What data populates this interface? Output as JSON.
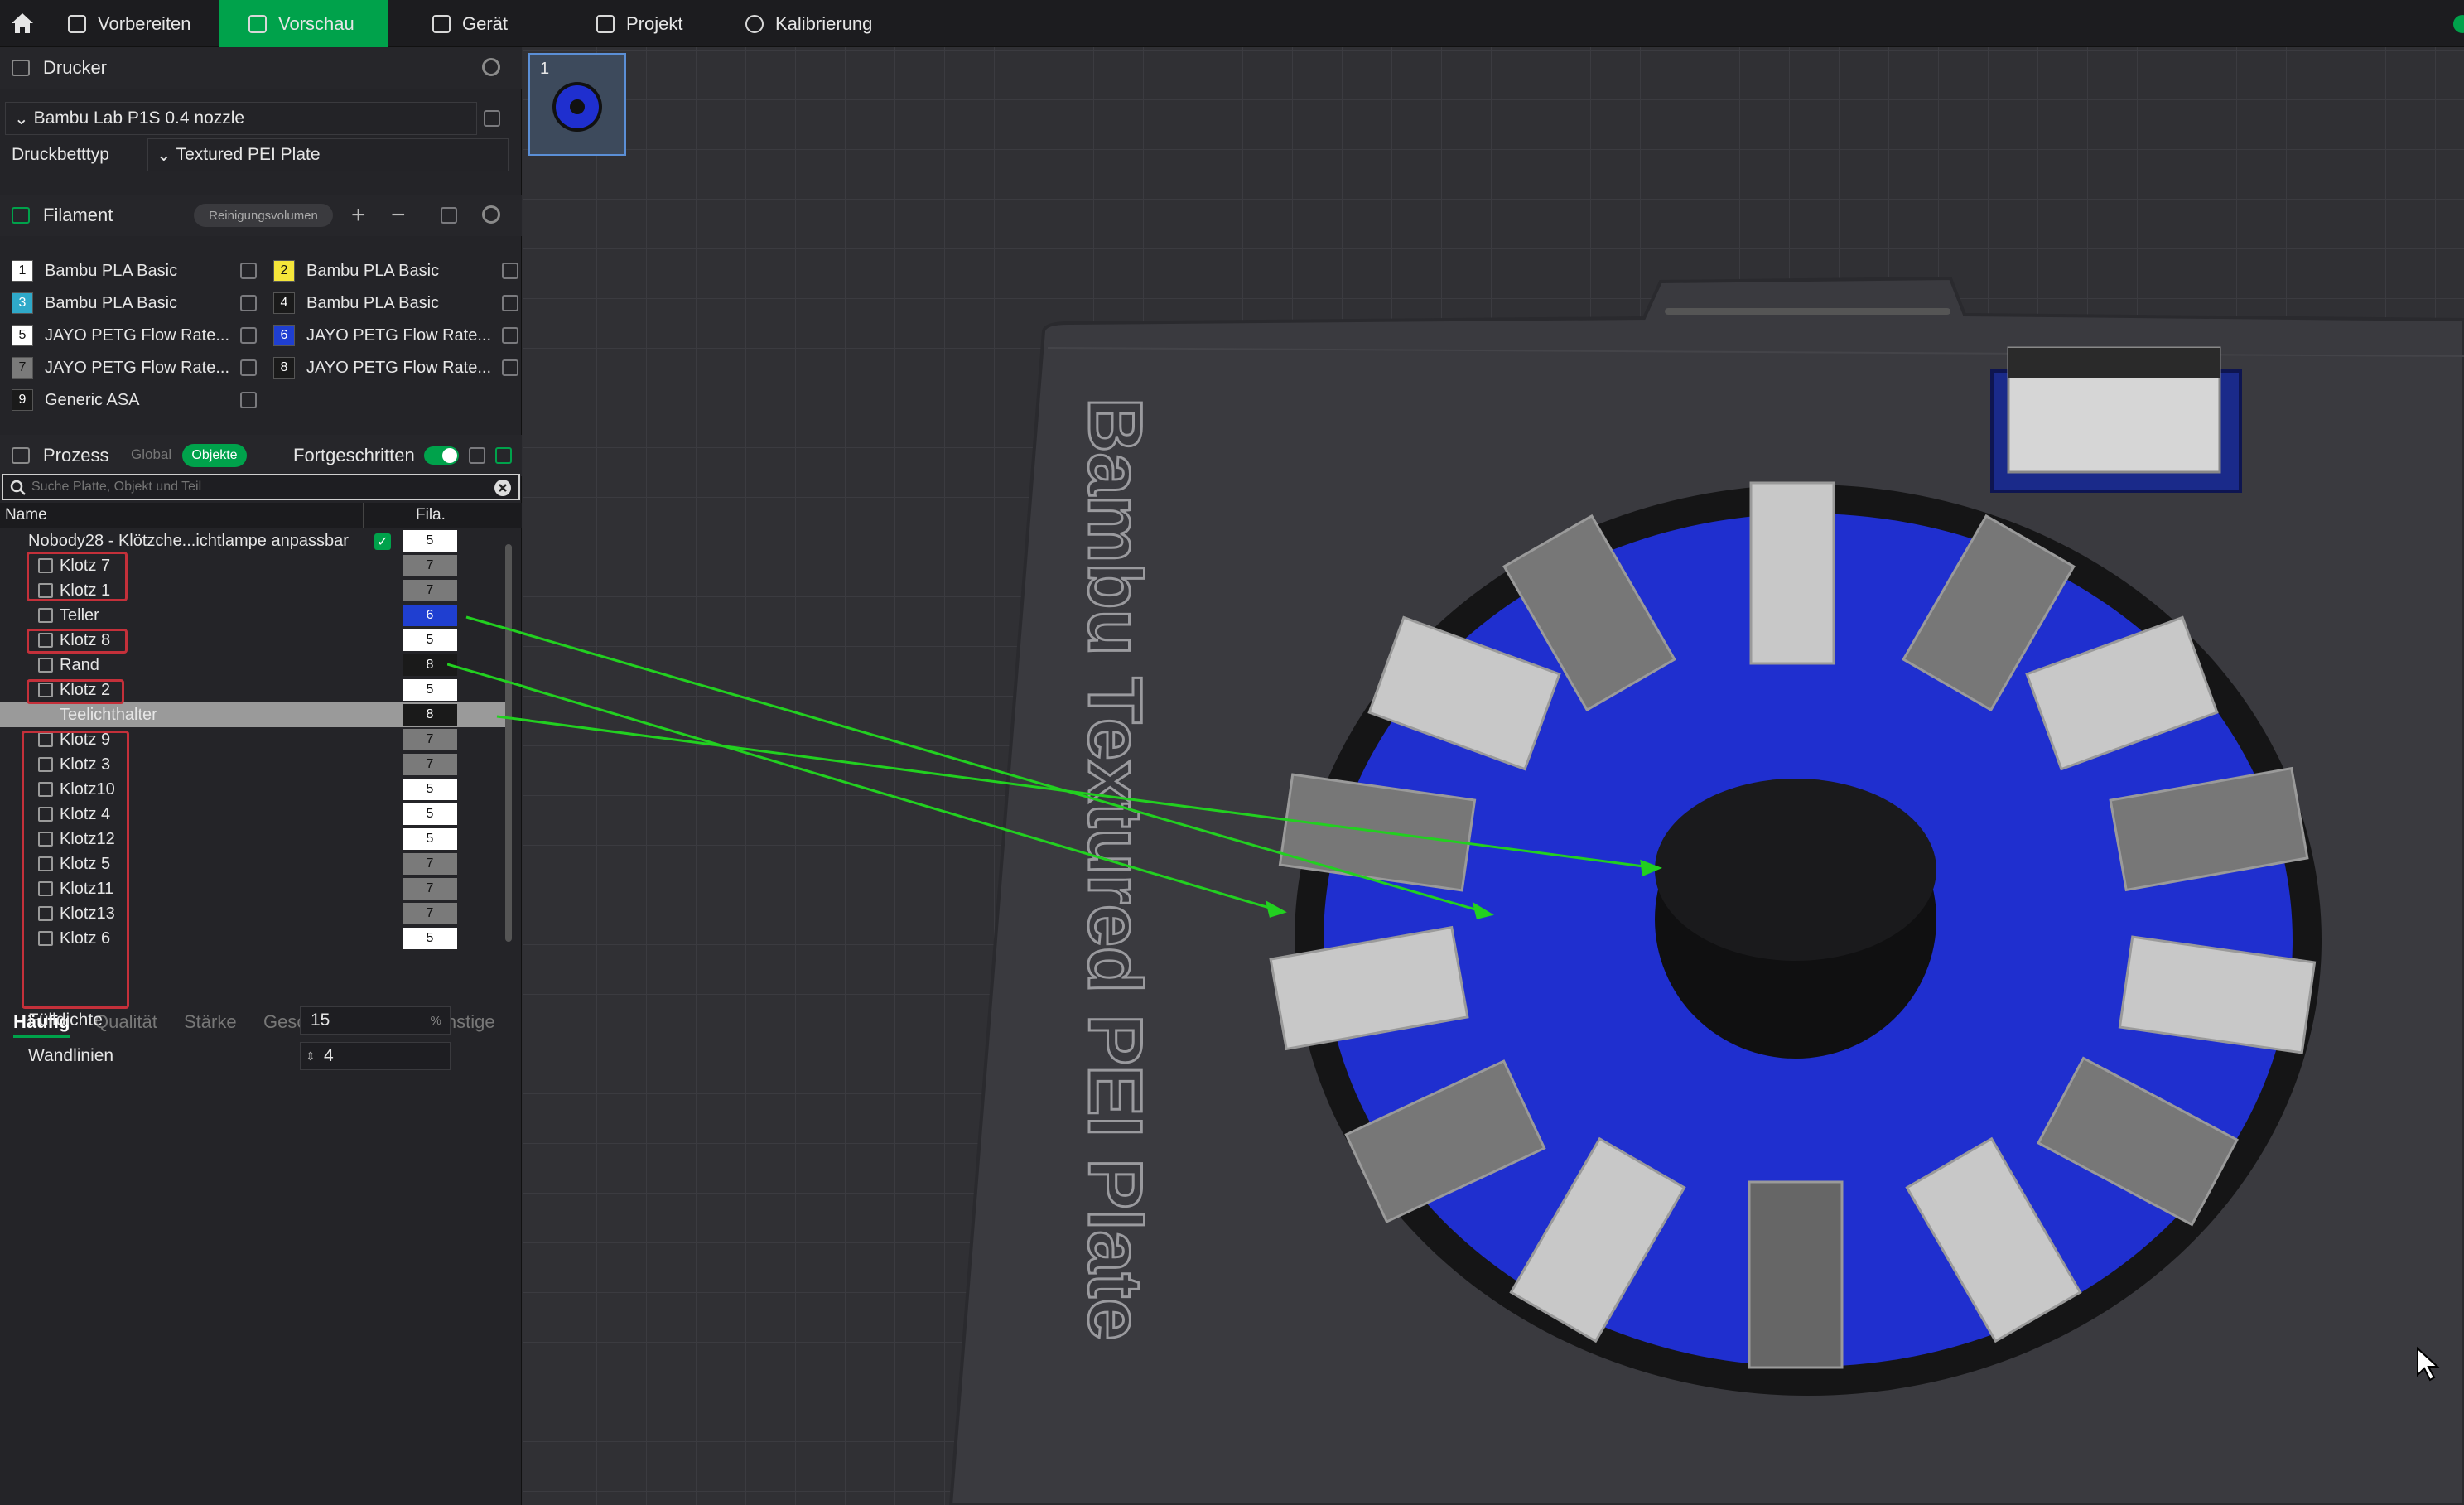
{
  "topbar": {
    "tabs": [
      {
        "label": "Vorbereiten"
      },
      {
        "label": "Vorschau"
      },
      {
        "label": "Gerät"
      },
      {
        "label": "Projekt"
      },
      {
        "label": "Kalibrierung"
      }
    ],
    "active_tab": "Vorschau",
    "accent": "#00a24b"
  },
  "printer": {
    "section_label": "Drucker",
    "printer_name": "Bambu Lab P1S 0.4 nozzle",
    "bed_label": "Druckbetttyp",
    "bed_value": "Textured PEI Plate"
  },
  "filament": {
    "section_label": "Filament",
    "purge_button": "Reinigungsvolumen",
    "items": [
      {
        "num": "1",
        "name": "Bambu PLA Basic",
        "color": "#ffffff",
        "text_color": "#111111"
      },
      {
        "num": "2",
        "name": "Bambu PLA Basic",
        "color": "#f5e63a",
        "text_color": "#111111"
      },
      {
        "num": "3",
        "name": "Bambu PLA Basic",
        "color": "#2fa9c9",
        "text_color": "#ffffff"
      },
      {
        "num": "4",
        "name": "Bambu PLA Basic",
        "color": "#1a1a1a",
        "text_color": "#ffffff"
      },
      {
        "num": "5",
        "name": "JAYO PETG Flow Rate...",
        "color": "#ffffff",
        "text_color": "#111111"
      },
      {
        "num": "6",
        "name": "JAYO PETG Flow Rate...",
        "color": "#1f3fd1",
        "text_color": "#ffffff"
      },
      {
        "num": "7",
        "name": "JAYO PETG Flow Rate...",
        "color": "#7a7a7a",
        "text_color": "#111111"
      },
      {
        "num": "8",
        "name": "JAYO PETG Flow Rate...",
        "color": "#1a1a1a",
        "text_color": "#ffffff"
      },
      {
        "num": "9",
        "name": "Generic ASA",
        "color": "#1a1a1a",
        "text_color": "#ffffff"
      }
    ]
  },
  "process": {
    "section_label": "Prozess",
    "global_label": "Global",
    "objects_label": "Objekte",
    "advanced_label": "Fortgeschritten",
    "search_placeholder": "Suche Platte, Objekt und Teil",
    "col_name": "Name",
    "col_fila": "Fila.",
    "tree": [
      {
        "name": "Nobody28 - Klötzche...ichtlampe anpassbar",
        "fila": "5",
        "root": true,
        "checked": true
      },
      {
        "name": "Klotz 7",
        "fila": "7"
      },
      {
        "name": "Klotz 1",
        "fila": "7"
      },
      {
        "name": "Teller",
        "fila": "6"
      },
      {
        "name": "Klotz 8",
        "fila": "5"
      },
      {
        "name": "Rand",
        "fila": "8"
      },
      {
        "name": "Klotz 2",
        "fila": "5"
      },
      {
        "name": "Teelichthalter",
        "fila": "8",
        "selected": true
      },
      {
        "name": "Klotz 9",
        "fila": "7"
      },
      {
        "name": "Klotz 3",
        "fila": "7"
      },
      {
        "name": "Klotz10",
        "fila": "5"
      },
      {
        "name": "Klotz 4",
        "fila": "5"
      },
      {
        "name": "Klotz12",
        "fila": "5"
      },
      {
        "name": "Klotz 5",
        "fila": "7"
      },
      {
        "name": "Klotz11",
        "fila": "7"
      },
      {
        "name": "Klotz13",
        "fila": "7"
      },
      {
        "name": "Klotz 6",
        "fila": "5"
      }
    ],
    "tabs": [
      "Häufig",
      "Qualität",
      "Stärke",
      "Geschwindigkeit",
      "Sonstige"
    ],
    "params": [
      {
        "label": "Fülldichte",
        "value": "15",
        "unit": "%"
      },
      {
        "label": "Wandlinien",
        "value": "4",
        "unit": ""
      }
    ]
  },
  "viewport": {
    "plate_number": "1",
    "plate_label": "Bambu Textured PEI Plate"
  }
}
